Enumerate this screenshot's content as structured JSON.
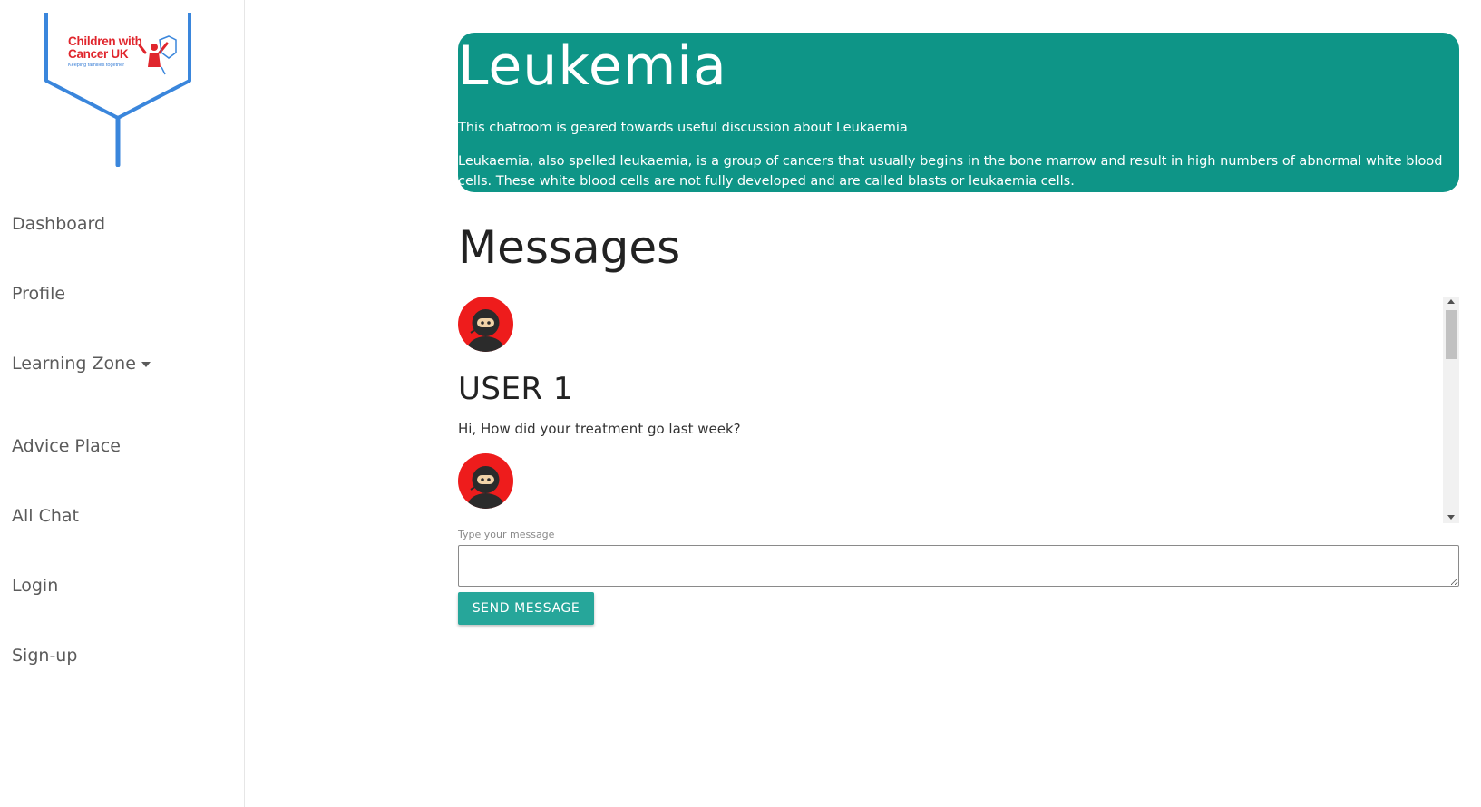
{
  "sidebar": {
    "logo": {
      "text_line1": "Children with",
      "text_line2": "Cancer UK",
      "tagline": "Keeping families together"
    },
    "items": [
      {
        "label": "Dashboard"
      },
      {
        "label": "Profile"
      },
      {
        "label": "Learning Zone"
      },
      {
        "label": "Advice Place"
      },
      {
        "label": "All Chat"
      },
      {
        "label": "Login"
      },
      {
        "label": "Sign-up"
      }
    ]
  },
  "banner": {
    "title": "Leukemia",
    "subtitle": "This chatroom is geared towards useful discussion about Leukaemia",
    "description": "Leukaemia, also spelled leukaemia, is a group of cancers that usually begins in the bone marrow and result in high numbers of abnormal white blood cells. These white blood cells are not fully developed and are called blasts or leukaemia cells.",
    "color": "#0e9587"
  },
  "messages": {
    "title": "Messages",
    "items": [
      {
        "username": "USER 1",
        "text": "Hi, How did your treatment go last week?",
        "avatar": "ninja-avatar-icon"
      },
      {
        "username": "",
        "text": "",
        "avatar": "ninja-avatar-icon"
      }
    ]
  },
  "composer": {
    "label": "Type your message",
    "value": "",
    "send_label": "SEND MESSAGE",
    "button_color": "#26a69a"
  }
}
